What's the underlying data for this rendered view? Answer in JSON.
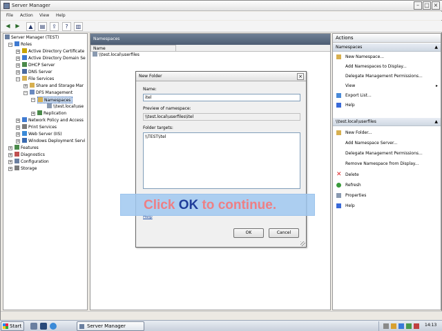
{
  "window": {
    "title": "Server Manager"
  },
  "menu": [
    "File",
    "Action",
    "View",
    "Help"
  ],
  "tree": {
    "items": [
      {
        "label": "Server Manager (TEST)",
        "level": 0
      },
      {
        "label": "Roles",
        "level": 1
      },
      {
        "label": "Active Directory Certificate",
        "level": 2
      },
      {
        "label": "Active Directory Domain Se",
        "level": 2
      },
      {
        "label": "DHCP Server",
        "level": 2
      },
      {
        "label": "DNS Server",
        "level": 2
      },
      {
        "label": "File Services",
        "level": 2
      },
      {
        "label": "Share and Storage Mar",
        "level": 3
      },
      {
        "label": "DFS Management",
        "level": 3
      },
      {
        "label": "Namespaces",
        "level": 4
      },
      {
        "label": "\\\\test.local\\use",
        "level": 5
      },
      {
        "label": "Replication",
        "level": 4
      },
      {
        "label": "Network Policy and Access",
        "level": 2
      },
      {
        "label": "Print Services",
        "level": 2
      },
      {
        "label": "Web Server (IIS)",
        "level": 2
      },
      {
        "label": "Windows Deployment Servi",
        "level": 2
      },
      {
        "label": "Features",
        "level": 1
      },
      {
        "label": "Diagnostics",
        "level": 1
      },
      {
        "label": "Configuration",
        "level": 1
      },
      {
        "label": "Storage",
        "level": 1
      }
    ]
  },
  "center": {
    "header": "Namespaces",
    "column_name": "Name",
    "rows": [
      "\\\\test.local\\userfiles"
    ]
  },
  "actions": {
    "header": "Actions",
    "section1": {
      "title": "Namespaces",
      "items": [
        "New Namespace...",
        "Add Namespaces to Display...",
        "Delegate Management Permissions...",
        "View",
        "Export List...",
        "Help"
      ]
    },
    "section2": {
      "title": "\\\\test.local\\userfiles",
      "items": [
        "New Folder...",
        "Add Namespace Server...",
        "Delegate Management Permissions...",
        "Remove Namespace from Display...",
        "Delete",
        "Refresh",
        "Properties",
        "Help"
      ]
    }
  },
  "dialog": {
    "title": "New Folder",
    "name_label": "Name:",
    "name_value": "itel",
    "preview_label": "Preview of namespace:",
    "preview_value": "\\\\test.local\\userfiles\\itel",
    "targets_label": "Folder targets:",
    "targets": [
      "\\\\TEST\\itel"
    ],
    "help_link": "Help",
    "ok_label": "OK",
    "cancel_label": "Cancel"
  },
  "callout": {
    "part1": "Click ",
    "part2": "OK",
    "part3": " to continue."
  },
  "taskbar": {
    "start_label": "Start",
    "task_label": "Server Manager",
    "clock": "14:13"
  },
  "colors": {
    "callout_bg": "#a0c8f0",
    "callout_text": "#ee7f84",
    "callout_key": "#1f3d9a",
    "pane_header": "#5a6a80"
  }
}
